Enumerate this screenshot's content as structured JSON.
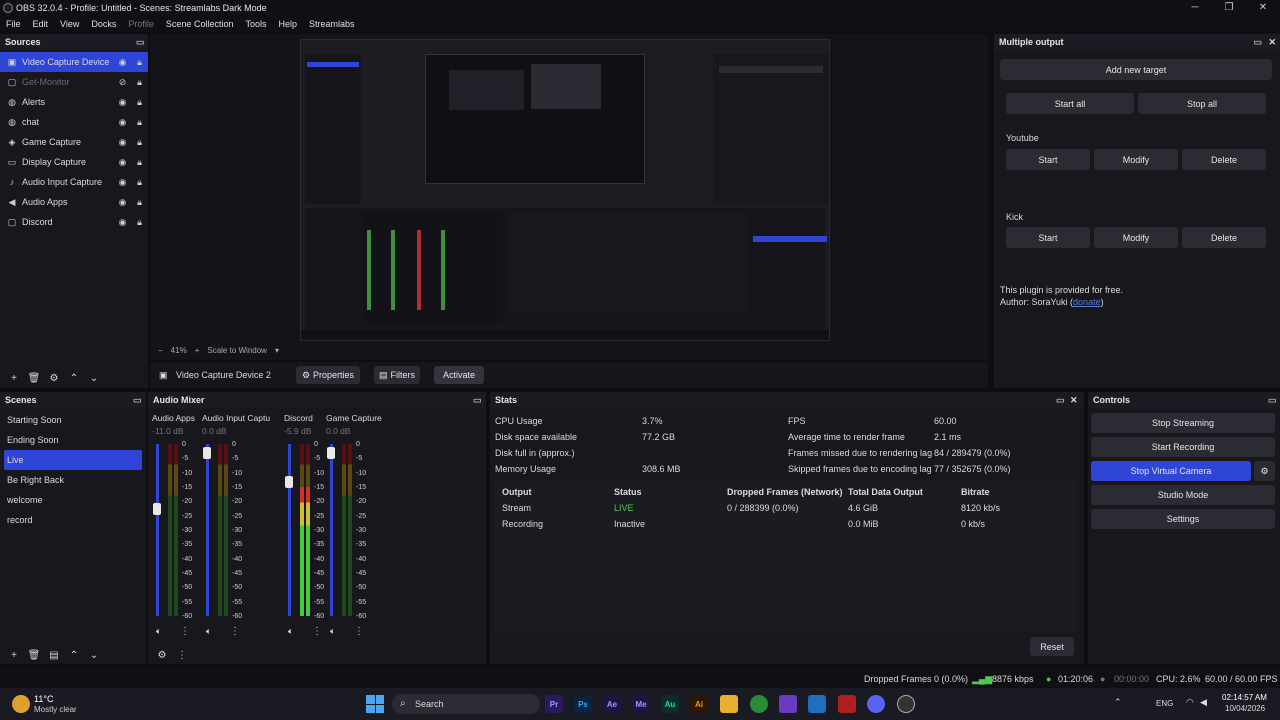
{
  "window": {
    "title": "OBS 32.0.4 - Profile: Untitled - Scenes: Streamlabs Dark Mode",
    "min": "─",
    "max": "❐",
    "close": "✕"
  },
  "menu": [
    "File",
    "Edit",
    "View",
    "Docks",
    "Profile",
    "Scene Collection",
    "Tools",
    "Help",
    "Streamlabs"
  ],
  "sources": {
    "title": "Sources",
    "items": [
      {
        "label": "Video Capture Device",
        "icon": "camera-icon"
      },
      {
        "label": "Get-Monitor",
        "icon": "window-icon"
      },
      {
        "label": "Alerts",
        "icon": "browser-icon"
      },
      {
        "label": "chat",
        "icon": "browser-icon"
      },
      {
        "label": "Game Capture",
        "icon": "gamepad-icon"
      },
      {
        "label": "Display Capture",
        "icon": "monitor-icon"
      },
      {
        "label": "Audio Input Capture",
        "icon": "microphone-icon"
      },
      {
        "label": "Audio Apps",
        "icon": "speaker-icon"
      },
      {
        "label": "Discord",
        "icon": "window-icon"
      }
    ]
  },
  "preview": {
    "zoom": "41%",
    "scale_label": "Scale to Window"
  },
  "context_bar": {
    "source": "Video Capture Device 2",
    "properties": "Properties",
    "filters": "Filters",
    "activate": "Activate"
  },
  "multiple_output": {
    "title": "Multiple output",
    "add_target": "Add new target",
    "start_all": "Start all",
    "stop_all": "Stop all",
    "targets": [
      {
        "name": "Youtube",
        "start": "Start",
        "modify": "Modify",
        "delete": "Delete"
      },
      {
        "name": "Kick",
        "start": "Start",
        "modify": "Modify",
        "delete": "Delete"
      }
    ],
    "note": "This plugin is provided for free.",
    "author": "Author: SoraYuki (",
    "donate": "donate",
    "author_end": ")"
  },
  "scenes": {
    "title": "Scenes",
    "items": [
      "Starting Soon",
      "Ending Soon",
      "Live",
      "Be Right Back",
      "welcome",
      "record"
    ]
  },
  "mixer": {
    "title": "Audio Mixer",
    "channels": [
      {
        "name": "Audio Apps",
        "db": "-11.0 dB",
        "level": 0.0,
        "fader": 0.62
      },
      {
        "name": "Audio Input Captu",
        "db": "0.0 dB",
        "level": 0.0,
        "fader": 0.95
      },
      {
        "name": "Discord",
        "db": "-5.9 dB",
        "level": 0.75,
        "fader": 0.78
      },
      {
        "name": "Game Capture",
        "db": "0.0 dB",
        "level": 0.0,
        "fader": 0.95
      }
    ],
    "scale": [
      "0",
      "-5",
      "-10",
      "-15",
      "-20",
      "-25",
      "-30",
      "-35",
      "-40",
      "-45",
      "-50",
      "-55",
      "-60"
    ]
  },
  "stats": {
    "title": "Stats",
    "left": [
      {
        "k": "CPU Usage",
        "v": "3.7%"
      },
      {
        "k": "Disk space available",
        "v": "77.2 GB"
      },
      {
        "k": "Disk full in (approx.)",
        "v": ""
      },
      {
        "k": "Memory Usage",
        "v": "308.6 MB"
      }
    ],
    "right": [
      {
        "k": "FPS",
        "v": "60.00"
      },
      {
        "k": "Average time to render frame",
        "v": "2.1 ms"
      },
      {
        "k": "Frames missed due to rendering lag",
        "v": "84 / 289479 (0.0%)"
      },
      {
        "k": "Skipped frames due to encoding lag",
        "v": "77 / 352675 (0.0%)"
      }
    ],
    "headers": [
      "Output",
      "Status",
      "Dropped Frames (Network)",
      "Total Data Output",
      "Bitrate"
    ],
    "rows": [
      [
        "Stream",
        "LIVE",
        "0 / 288399 (0.0%)",
        "4.6 GiB",
        "8120 kb/s"
      ],
      [
        "Recording",
        "Inactive",
        "",
        "0.0 MiB",
        "0 kb/s"
      ]
    ],
    "reset": "Reset"
  },
  "controls": {
    "title": "Controls",
    "stop_streaming": "Stop Streaming",
    "start_recording": "Start Recording",
    "stop_virtual_camera": "Stop Virtual Camera",
    "studio_mode": "Studio Mode",
    "settings": "Settings"
  },
  "statusbar": {
    "dropped": "Dropped Frames 0 (0.0%)",
    "kbps": "8876 kbps",
    "live_time": "01:20:06",
    "rec_time": "00:00:00",
    "cpu": "CPU: 2.6%",
    "fps": "60.00 / 60.00 FPS"
  },
  "taskbar": {
    "weather_temp": "11°C",
    "weather_desc": "Mostly clear",
    "search": "Search",
    "lang": "ENG",
    "time": "02:14:57 AM",
    "date": "10/04/2026",
    "apps": [
      {
        "label": "Pr",
        "color": "#2b1b5e",
        "fg": "#9f9fff"
      },
      {
        "label": "Ps",
        "color": "#0b2340",
        "fg": "#31a8ff"
      },
      {
        "label": "Ae",
        "color": "#1d1440",
        "fg": "#9999ff"
      },
      {
        "label": "Me",
        "color": "#1d1440",
        "fg": "#9999ff"
      },
      {
        "label": "Au",
        "color": "#0d2b2b",
        "fg": "#00e4bb"
      },
      {
        "label": "Ai",
        "color": "#2b1700",
        "fg": "#ff9a00"
      }
    ]
  },
  "colors": {
    "accent": "#2f45d8",
    "live": "#4fc94f",
    "bg": "#17171d"
  }
}
